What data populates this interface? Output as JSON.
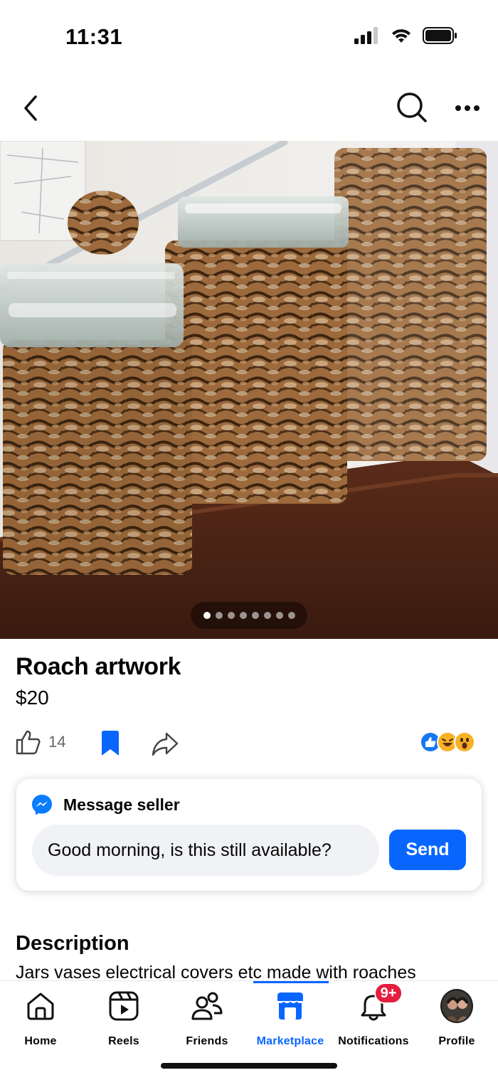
{
  "status_bar": {
    "time": "11:31",
    "icons": [
      "signal-icon",
      "wifi-icon",
      "battery-icon"
    ]
  },
  "top_nav": {
    "icons": [
      "back-icon",
      "search-icon",
      "more-icon"
    ]
  },
  "listing": {
    "photo_count": 8,
    "photo_active_index": 0,
    "title": "Roach artwork",
    "price": "$20",
    "like_count": "14",
    "reactions": [
      "like-reaction",
      "haha-reaction",
      "wow-reaction"
    ]
  },
  "message_card": {
    "heading": "Message seller",
    "input_value": "Good morning, is this still available?",
    "send_label": "Send"
  },
  "description": {
    "heading": "Description",
    "text": "Jars vases electrical covers etc made with roaches"
  },
  "tab_bar": {
    "tabs": [
      {
        "label": "Home",
        "icon": "home-icon"
      },
      {
        "label": "Reels",
        "icon": "reels-icon"
      },
      {
        "label": "Friends",
        "icon": "friends-icon"
      },
      {
        "label": "Marketplace",
        "icon": "marketplace-icon"
      },
      {
        "label": "Notifications",
        "icon": "bell-icon",
        "badge": "9+"
      },
      {
        "label": "Profile",
        "icon": "profile-avatar"
      }
    ],
    "active_tab": "Marketplace"
  },
  "colors": {
    "accent": "#0866ff",
    "badge": "#e41e3f",
    "input_bg": "#f0f2f5"
  }
}
